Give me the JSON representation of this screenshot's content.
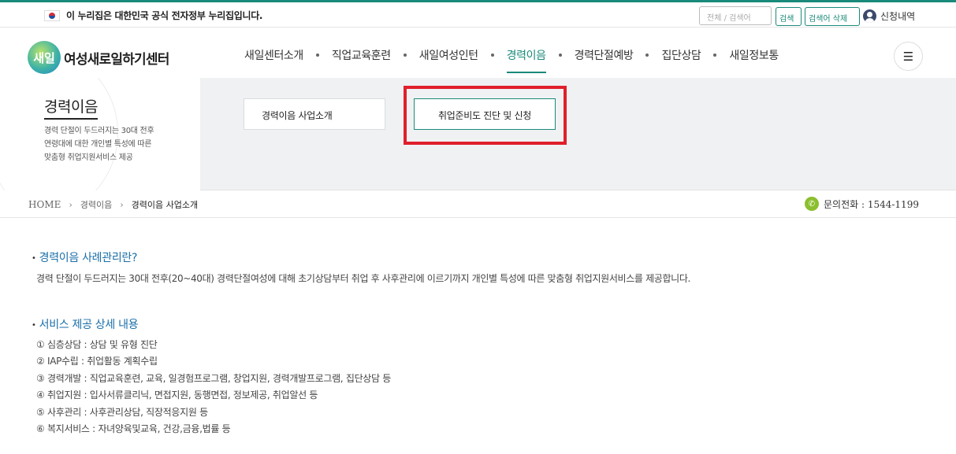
{
  "topbar": {
    "gov_notice": "이 누리집은 대한민국 공식 전자정부 누리집입니다.",
    "search_placeholder": "전체 / 검색어",
    "search_label": "검색",
    "clear_label": "검색어 삭제",
    "apply_status_label": "신청내역"
  },
  "header": {
    "logo_mark": "새일",
    "logo_text": "여성새로일하기센터",
    "nav": [
      {
        "label": "새일센터소개"
      },
      {
        "label": "직업교육훈련"
      },
      {
        "label": "새일여성인턴"
      },
      {
        "label": "경력이음"
      },
      {
        "label": "경력단절예방"
      },
      {
        "label": "집단상담"
      },
      {
        "label": "새일정보통"
      }
    ],
    "menu_icon": "☰"
  },
  "subvisual": {
    "title": "경력이음",
    "desc_lines": [
      "경력 단절이 두드러지는 30대 전후",
      "연령대에 대한 개인별 특성에 따른",
      "맞춤형 취업지원서비스 제공"
    ],
    "tabs": [
      {
        "label": "경력이음 사업소개"
      },
      {
        "label": "취업준비도 진단 및 신청"
      }
    ]
  },
  "breadcrumb": {
    "home": "HOME",
    "level1": "경력이음",
    "current": "경력이음 사업소개",
    "sep": "›"
  },
  "contact": {
    "label": "문의전화 : 1544-1199"
  },
  "content": {
    "section1_title": "경력이음 사례관리란?",
    "section1_text": "경력 단절이 두드러지는 30대 전후(20~40대) 경력단절여성에 대해 초기상담부터 취업 후 사후관리에 이르기까지 개인별 특성에 따른 맞춤형 취업지원서비스를 제공합니다.",
    "section2_title": "서비스 제공 상세 내용",
    "services": [
      "① 심층상담 : 상담 및 유형 진단",
      "② IAP수립 : 취업활동 계획수립",
      "③ 경력개발 : 직업교육훈련, 교육, 일경험프로그램, 창업지원, 경력개발프로그램, 집단상담 등",
      "④ 취업지원 : 입사서류클리닉, 면접지원, 동행면접, 정보제공, 취업알선 등",
      "⑤ 사후관리 : 사후관리상담, 직장적응지원 등",
      "⑥ 복지서비스 : 자녀양육및교육, 건강,금융,법률 등"
    ]
  },
  "colors": {
    "accent": "#1a8a7a",
    "heading_blue": "#1a6ea8",
    "highlight_red": "#e0202b"
  }
}
